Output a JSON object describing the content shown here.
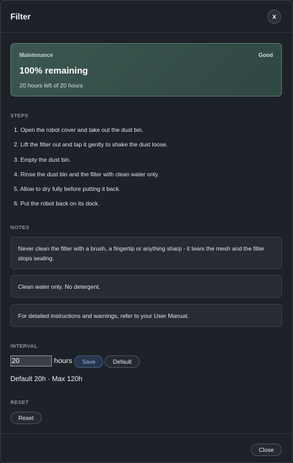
{
  "dialog": {
    "title": "Filter",
    "close_icon_label": "x"
  },
  "status": {
    "label": "Maintenance",
    "badge": "Good",
    "value": "100% remaining",
    "detail": "20 hours left of 20 hours",
    "remaining_fraction": 1.0,
    "accent_color": "#3b5650"
  },
  "steps": {
    "title": "STEPS",
    "items": [
      "1. Open the robot cover and take out the dust bin.",
      "2. Lift the filter out and tap it gently to shake the dust loose.",
      "3. Empty the dust bin.",
      "4. Rinse the dust bin and the filter with clean water only.",
      "5. Allow to dry fully before putting it back.",
      "6. Put the robot back on its dock."
    ]
  },
  "notes": {
    "title": "NOTES",
    "items": [
      "Never clean the filter with a brush, a fingertip or anything sharp - it tears the mesh and the filter stops sealing.",
      "Clean water only. No detergent.",
      "For detailed instructions and warnings, refer to your User Manual."
    ]
  },
  "interval": {
    "title": "INTERVAL",
    "value": "20",
    "unit": "hours",
    "save_label": "Save",
    "default_label": "Default",
    "hint": "Default 20h · Max 120h"
  },
  "reset": {
    "title": "RESET",
    "button_label": "Reset"
  },
  "footer": {
    "close_label": "Close"
  }
}
